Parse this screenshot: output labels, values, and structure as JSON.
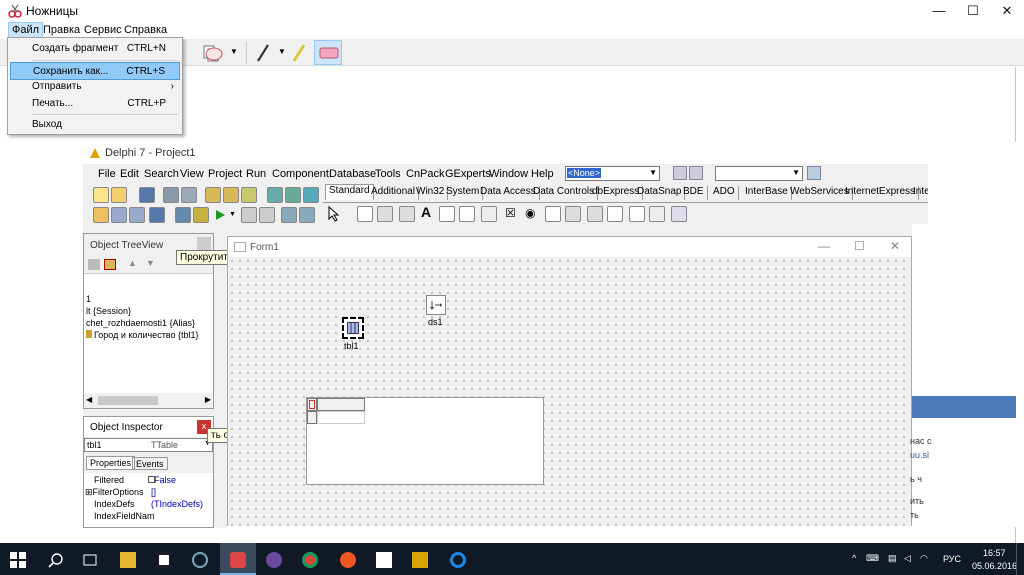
{
  "snipping_tool": {
    "title": "Ножницы",
    "menu": [
      "Файл",
      "Правка",
      "Сервис",
      "Справка"
    ],
    "file_menu": [
      {
        "label": "Создать фрагмент",
        "shortcut": "CTRL+N"
      },
      {
        "label": "Сохранить как...",
        "shortcut": "CTRL+S"
      },
      {
        "label": "Отправить",
        "shortcut": ""
      },
      {
        "label": "Печать...",
        "shortcut": "CTRL+P"
      },
      {
        "label": "Выход",
        "shortcut": ""
      }
    ],
    "window_buttons": {
      "minimize": "—",
      "maximize": "☐",
      "close": "✕"
    }
  },
  "delphi": {
    "title": "Delphi 7 - Project1",
    "menu": [
      "File",
      "Edit",
      "Search",
      "View",
      "Project",
      "Run",
      "Component",
      "Database",
      "Tools",
      "CnPack",
      "GExperts",
      "Window",
      "Help"
    ],
    "desktop_combo": "<None>",
    "palette_tabs": [
      "Standard",
      "Additional",
      "Win32",
      "System",
      "Data Access",
      "Data Controls",
      "dbExpress",
      "DataSnap",
      "BDE",
      "ADO",
      "InterBase",
      "WebServices",
      "InternetExpress",
      "Inte"
    ]
  },
  "object_treeview": {
    "title": "Object TreeView",
    "lines": [
      "1",
      "lt {Session}",
      "chet_rozhdaemosti1 {Alias}",
      "Город и количество {tbl1}"
    ]
  },
  "tooltip_scroll": "Прокрутить окно",
  "tooltip_scroll_partial": "ть окно",
  "object_inspector": {
    "title": "Object Inspector",
    "selected": "tbl1",
    "selected_type": "TTable",
    "tabs": [
      "Properties",
      "Events"
    ],
    "rows": [
      {
        "name": "Filtered",
        "value": "False"
      },
      {
        "name": "⊞FilterOptions",
        "value": "[]"
      },
      {
        "name": "IndexDefs",
        "value": "(TIndexDefs)"
      },
      {
        "name": "IndexFieldNam",
        "value": ""
      }
    ]
  },
  "form1": {
    "title": "Form1",
    "components": {
      "table": "tbl1",
      "datasource": "ds1"
    }
  },
  "right_peek": [
    "нас с",
    "uu.sl",
    "ь ч",
    "ить",
    "ть",
    "ь"
  ],
  "taskbar": {
    "lang": "РУС",
    "time": "16:57",
    "date": "05.06.2016"
  }
}
